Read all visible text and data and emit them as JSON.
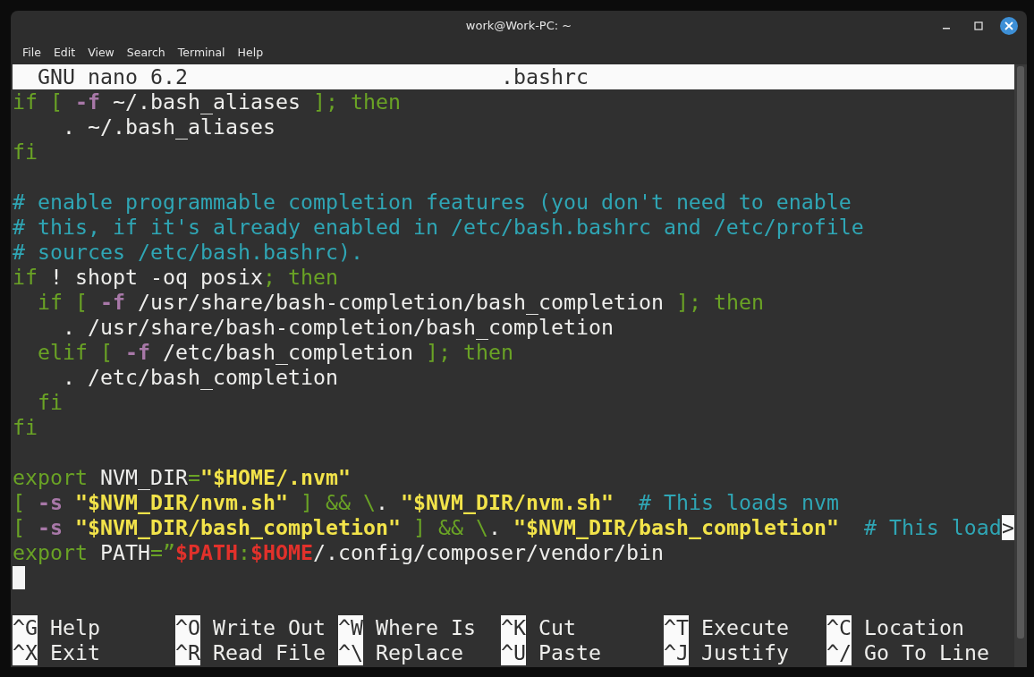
{
  "window": {
    "title": "work@Work-PC: ~"
  },
  "menu": [
    "File",
    "Edit",
    "View",
    "Search",
    "Terminal",
    "Help"
  ],
  "editor": {
    "app": "GNU nano 6.2",
    "filename": ".bashrc",
    "lines": [
      {
        "kind": "code",
        "segments": [
          {
            "kind": "keyword",
            "text": "if [ "
          },
          {
            "kind": "option",
            "text": "-f"
          },
          {
            "kind": "text",
            "text": " ~/.bash_aliases "
          },
          {
            "kind": "keyword",
            "text": "]; then"
          }
        ]
      },
      {
        "kind": "code",
        "segments": [
          {
            "kind": "text",
            "text": "    . ~/.bash_aliases"
          }
        ]
      },
      {
        "kind": "code",
        "segments": [
          {
            "kind": "keyword",
            "text": "fi"
          }
        ]
      },
      {
        "kind": "blank"
      },
      {
        "kind": "code",
        "segments": [
          {
            "kind": "comment",
            "text": "# enable programmable completion features (you don't need to enable"
          }
        ]
      },
      {
        "kind": "code",
        "segments": [
          {
            "kind": "comment",
            "text": "# this, if it's already enabled in /etc/bash.bashrc and /etc/profile"
          }
        ]
      },
      {
        "kind": "code",
        "segments": [
          {
            "kind": "comment",
            "text": "# sources /etc/bash.bashrc)."
          }
        ]
      },
      {
        "kind": "code",
        "segments": [
          {
            "kind": "keyword",
            "text": "if"
          },
          {
            "kind": "text",
            "text": " ! shopt -oq posix"
          },
          {
            "kind": "keyword",
            "text": "; then"
          }
        ]
      },
      {
        "kind": "code",
        "segments": [
          {
            "kind": "keyword",
            "text": "  if [ "
          },
          {
            "kind": "option",
            "text": "-f"
          },
          {
            "kind": "text",
            "text": " /usr/share/bash-completion/bash_completion "
          },
          {
            "kind": "keyword",
            "text": "]; then"
          }
        ]
      },
      {
        "kind": "code",
        "segments": [
          {
            "kind": "text",
            "text": "    . /usr/share/bash-completion/bash_completion"
          }
        ]
      },
      {
        "kind": "code",
        "segments": [
          {
            "kind": "keyword",
            "text": "  elif [ "
          },
          {
            "kind": "option",
            "text": "-f"
          },
          {
            "kind": "text",
            "text": " /etc/bash_completion "
          },
          {
            "kind": "keyword",
            "text": "]; then"
          }
        ]
      },
      {
        "kind": "code",
        "segments": [
          {
            "kind": "text",
            "text": "    . /etc/bash_completion"
          }
        ]
      },
      {
        "kind": "code",
        "segments": [
          {
            "kind": "keyword",
            "text": "  fi"
          }
        ]
      },
      {
        "kind": "code",
        "segments": [
          {
            "kind": "keyword",
            "text": "fi"
          }
        ]
      },
      {
        "kind": "blank"
      },
      {
        "kind": "code",
        "segments": [
          {
            "kind": "keyword",
            "text": "export"
          },
          {
            "kind": "text",
            "text": " NVM_DIR"
          },
          {
            "kind": "keyword",
            "text": "="
          },
          {
            "kind": "string",
            "text": "\"$HOME/.nvm\""
          }
        ]
      },
      {
        "kind": "code",
        "segments": [
          {
            "kind": "keyword",
            "text": "[ "
          },
          {
            "kind": "option",
            "text": "-s "
          },
          {
            "kind": "string",
            "text": "\"$NVM_DIR/nvm.sh\""
          },
          {
            "kind": "keyword",
            "text": " ] && \\"
          },
          {
            "kind": "text",
            "text": ". "
          },
          {
            "kind": "string",
            "text": "\"$NVM_DIR/nvm.sh\""
          },
          {
            "kind": "comment",
            "text": "  # This loads nvm"
          }
        ]
      },
      {
        "kind": "code",
        "overflow": ">",
        "segments": [
          {
            "kind": "keyword",
            "text": "[ "
          },
          {
            "kind": "option",
            "text": "-s "
          },
          {
            "kind": "string",
            "text": "\"$NVM_DIR/bash_completion\""
          },
          {
            "kind": "keyword",
            "text": " ] && \\"
          },
          {
            "kind": "text",
            "text": ". "
          },
          {
            "kind": "string",
            "text": "\"$NVM_DIR/bash_completion\""
          },
          {
            "kind": "comment",
            "text": "  # This load"
          }
        ]
      },
      {
        "kind": "code",
        "segments": [
          {
            "kind": "keyword",
            "text": "export"
          },
          {
            "kind": "text",
            "text": " PATH"
          },
          {
            "kind": "keyword",
            "text": "=”"
          },
          {
            "kind": "variable",
            "text": "$PATH"
          },
          {
            "kind": "keyword",
            "text": ":"
          },
          {
            "kind": "variable",
            "text": "$HOME"
          },
          {
            "kind": "text",
            "text": "/.config/composer/vendor/bin"
          }
        ]
      },
      {
        "kind": "cursor"
      },
      {
        "kind": "blank"
      }
    ],
    "shortcuts": [
      [
        {
          "key": "^G",
          "label": "Help"
        },
        {
          "key": "^O",
          "label": "Write Out"
        },
        {
          "key": "^W",
          "label": "Where Is"
        },
        {
          "key": "^K",
          "label": "Cut"
        },
        {
          "key": "^T",
          "label": "Execute"
        },
        {
          "key": "^C",
          "label": "Location"
        }
      ],
      [
        {
          "key": "^X",
          "label": "Exit"
        },
        {
          "key": "^R",
          "label": "Read File"
        },
        {
          "key": "^\\",
          "label": "Replace"
        },
        {
          "key": "^U",
          "label": "Paste"
        },
        {
          "key": "^J",
          "label": "Justify"
        },
        {
          "key": "^/",
          "label": "Go To Line"
        }
      ]
    ]
  }
}
